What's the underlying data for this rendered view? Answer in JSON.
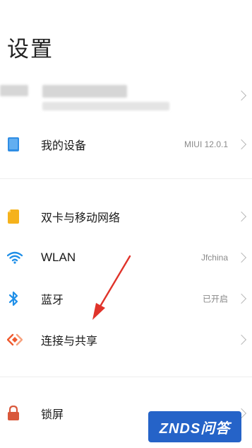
{
  "page": {
    "title": "设置"
  },
  "rows": {
    "my_device": {
      "label": "我的设备",
      "value": "MIUI 12.0.1"
    },
    "sim": {
      "label": "双卡与移动网络"
    },
    "wlan": {
      "label": "WLAN",
      "value": "Jfchina"
    },
    "bluetooth": {
      "label": "蓝牙",
      "value": "已开启"
    },
    "connection": {
      "label": "连接与共享"
    },
    "lock": {
      "label": "锁屏"
    }
  },
  "watermark": {
    "text": "ZNDS问答"
  },
  "colors": {
    "device_icon": "#2f8de4",
    "sim_icon": "#f5b21c",
    "wifi_icon": "#1f8fe8",
    "bluetooth_icon": "#1f8fe8",
    "share_icon": "#ef5a2f",
    "lock_icon": "#d9583b",
    "annotation_arrow": "#e0332a",
    "watermark_bg": "#2563c8"
  },
  "icons": {
    "device": "phone-device-icon",
    "sim": "sim-card-icon",
    "wifi": "wifi-icon",
    "bluetooth": "bluetooth-icon",
    "share": "connection-share-icon",
    "lock": "lock-icon"
  }
}
